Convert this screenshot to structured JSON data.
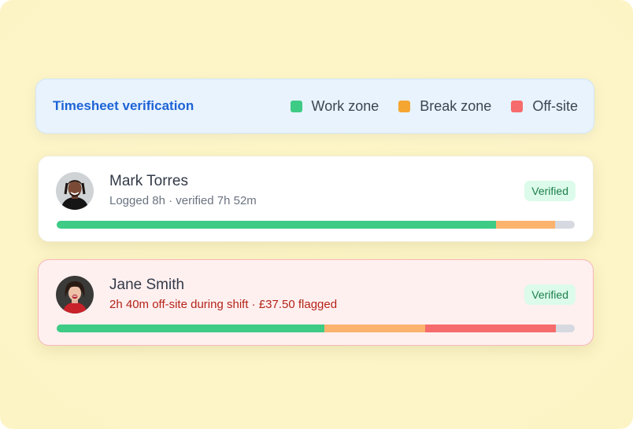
{
  "legend": {
    "title": "Timesheet verification",
    "items": [
      {
        "label": "Work zone",
        "color": "#3ecb86"
      },
      {
        "label": "Break zone",
        "color": "#f5a531"
      },
      {
        "label": "Off-site",
        "color": "#f66b6b"
      }
    ]
  },
  "employees": [
    {
      "name": "Mark Torres",
      "detail": "Logged 8h · verified 7h 52m",
      "badge": "Verified",
      "flagged": false,
      "segments_fraction": {
        "work": 0.848,
        "break": 0.114,
        "offsite": 0.0
      }
    },
    {
      "name": "Jane Smith",
      "detail": "2h 40m off-site during shift · £37.50 flagged",
      "badge": "Verified",
      "flagged": true,
      "segments_fraction": {
        "work": 0.517,
        "break": 0.194,
        "offsite": 0.253
      }
    }
  ],
  "colors": {
    "work_bar": "#3ecb86",
    "break_bar": "#fbb36e",
    "offsite_bar": "#f66b6b",
    "track": "#d6d9e0"
  }
}
